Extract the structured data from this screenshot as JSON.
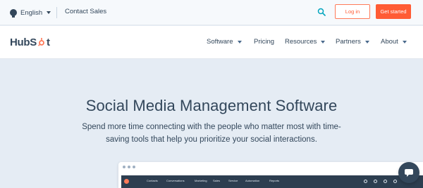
{
  "utility_bar": {
    "language": "English",
    "contact": "Contact Sales",
    "login_label": "Log in",
    "get_started_label": "Get started"
  },
  "nav": {
    "logo_text_left": "HubS",
    "logo_text_right": "t",
    "items": [
      {
        "label": "Software",
        "has_caret": true
      },
      {
        "label": "Pricing",
        "has_caret": false
      },
      {
        "label": "Resources",
        "has_caret": true
      },
      {
        "label": "Partners",
        "has_caret": true
      },
      {
        "label": "About",
        "has_caret": true
      }
    ]
  },
  "hero": {
    "title": "Social Media Management Software",
    "subtitle": "Spend more time connecting with the people who matter most with time-saving tools that help you prioritize your social interactions."
  },
  "app_preview": {
    "menu": [
      "Contacts",
      "Conversations",
      "Marketing",
      "Sales",
      "Service",
      "Automation",
      "Reports"
    ]
  },
  "colors": {
    "accent": "#ff5c35",
    "text": "#33475b",
    "hero_bg": "#e5ecf4",
    "app_bar": "#2d3e50"
  },
  "icons": {
    "language": "globe-icon",
    "search": "search-icon",
    "chat": "chat-icon"
  }
}
